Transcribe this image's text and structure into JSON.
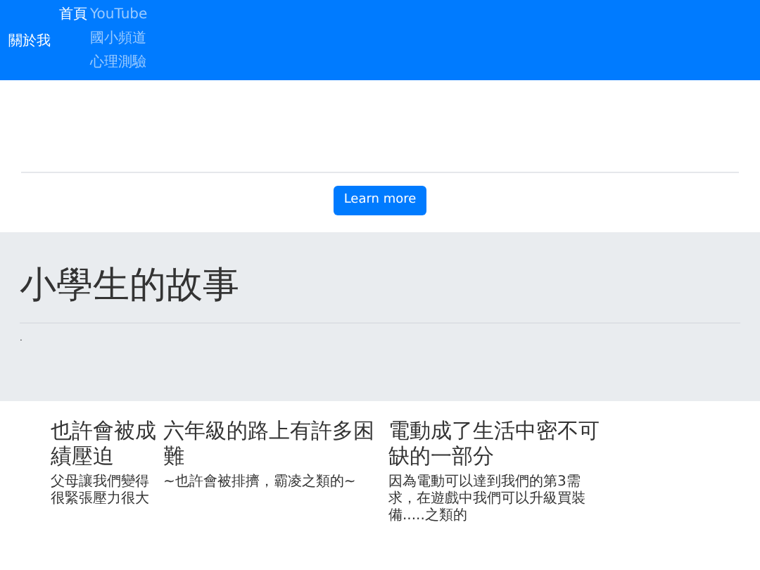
{
  "navbar": {
    "brand": "關於我",
    "links": [
      {
        "label": "首頁",
        "selected": true
      },
      {
        "label": "YouTube",
        "selected": false
      },
      {
        "label": "國小頻道",
        "selected": false
      },
      {
        "label": "心理測驗",
        "selected": false
      }
    ]
  },
  "button": "Learn more",
  "jumbotron": {
    "title": "小學生的故事",
    "text": "."
  },
  "cards": [
    {
      "heading": "也許會被成績壓迫",
      "text": "父母讓我們變得很緊張壓力很大"
    },
    {
      "heading": "六年級的路上有許多困難",
      "text": "~也許會被排擠，霸凌之類的~"
    },
    {
      "heading": "電動成了生活中密不可缺的一部分",
      "text": "因為電動可以達到我們的第3需求，在遊戲中我們可以升級買裝備.....之類的"
    }
  ]
}
